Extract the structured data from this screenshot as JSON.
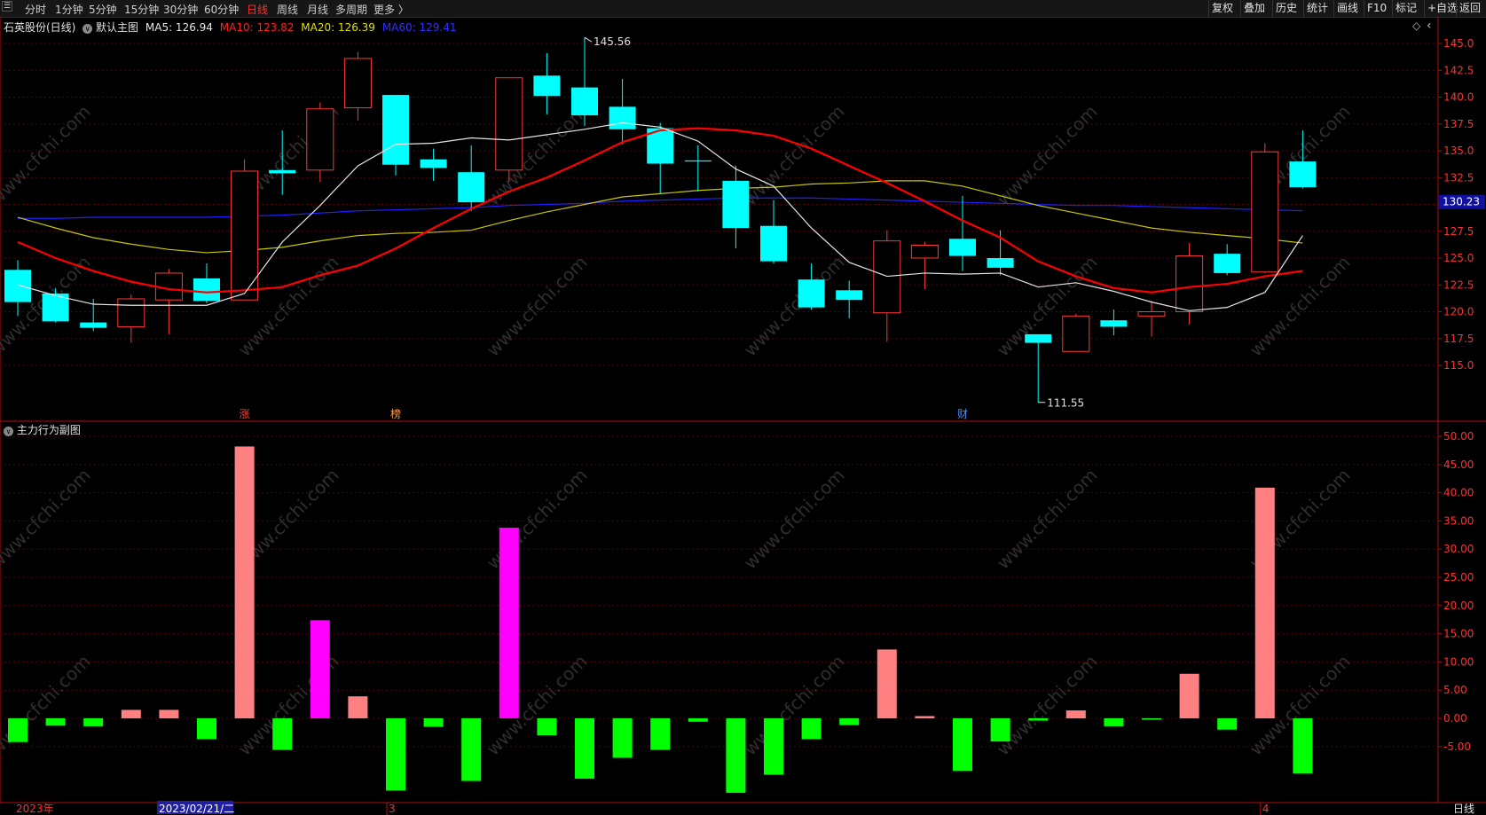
{
  "toolbar": {
    "left_items": [
      "分时",
      "1分钟",
      "5分钟",
      "15分钟",
      "30分钟",
      "60分钟",
      "日线",
      "周线",
      "月线",
      "多周期",
      "更多 〉"
    ],
    "active_item": "日线",
    "right_items": [
      "复权",
      "叠加",
      "历史",
      "统计",
      "画线",
      "F10",
      "标记",
      "+自选",
      "返回"
    ]
  },
  "main_chart": {
    "stock_title": "石英股份(日线)",
    "template": "默认主图",
    "ma5_text": "MA5: 126.94",
    "ma10_text": "MA10: 123.82",
    "ma20_text": "MA20: 126.39",
    "ma60_text": "MA60: 129.41",
    "high_label": "145.56",
    "low_label": "111.55",
    "current_price": "130.23",
    "markers": [
      "涨",
      "榜",
      "财"
    ],
    "settings_icon": "diamond-icon",
    "collapse_icon": "chevron-left-icon",
    "price_ticks": [
      "145.0",
      "142.5",
      "140.0",
      "137.5",
      "135.0",
      "132.5",
      "130.0",
      "127.5",
      "125.0",
      "122.5",
      "120.0",
      "117.5",
      "115.0"
    ]
  },
  "sub_chart": {
    "title": "主力行为副图",
    "ticks": [
      "50.00",
      "45.00",
      "40.00",
      "35.00",
      "30.00",
      "25.00",
      "20.00",
      "15.00",
      "10.00",
      "5.00",
      "0.00",
      "-5.00"
    ]
  },
  "date_axis": {
    "labels": [
      "2023年",
      "2023/02/21/二",
      "3",
      "4"
    ],
    "period": "日线"
  },
  "watermark": "www.cfchi.com",
  "colors": {
    "up": "#ff3838",
    "down": "#00ffff",
    "ma5": "#e6e6e6",
    "ma10": "#ff0000",
    "ma20": "#c8c800",
    "ma60": "#2020ff",
    "bar_up": "#ff8080",
    "bar_down": "#00ff00",
    "bar_major": "#ff00ff"
  },
  "chart_data": {
    "type": "candlestick",
    "candles": [
      {
        "o": 123.9,
        "h": 124.8,
        "l": 119.6,
        "c": 120.9
      },
      {
        "o": 121.7,
        "h": 122.2,
        "l": 119.0,
        "c": 119.1
      },
      {
        "o": 119.0,
        "h": 121.2,
        "l": 118.2,
        "c": 118.5
      },
      {
        "o": 118.6,
        "h": 121.6,
        "l": 117.1,
        "c": 121.2
      },
      {
        "o": 121.1,
        "h": 124.0,
        "l": 117.9,
        "c": 123.6
      },
      {
        "o": 123.1,
        "h": 124.5,
        "l": 120.8,
        "c": 121.0
      },
      {
        "o": 121.1,
        "h": 134.2,
        "l": 121.1,
        "c": 133.1
      },
      {
        "o": 133.2,
        "h": 136.9,
        "l": 130.9,
        "c": 132.9
      },
      {
        "o": 133.2,
        "h": 139.5,
        "l": 132.1,
        "c": 138.9
      },
      {
        "o": 139.0,
        "h": 144.2,
        "l": 137.8,
        "c": 143.6
      },
      {
        "o": 140.2,
        "h": 140.2,
        "l": 132.7,
        "c": 133.7
      },
      {
        "o": 134.2,
        "h": 135.2,
        "l": 132.2,
        "c": 133.4
      },
      {
        "o": 133.0,
        "h": 135.5,
        "l": 129.4,
        "c": 130.2
      },
      {
        "o": 133.2,
        "h": 141.8,
        "l": 132.1,
        "c": 141.8
      },
      {
        "o": 142.0,
        "h": 144.1,
        "l": 138.4,
        "c": 140.1
      },
      {
        "o": 140.9,
        "h": 145.56,
        "l": 137.3,
        "c": 138.3
      },
      {
        "o": 139.1,
        "h": 141.7,
        "l": 135.6,
        "c": 137.0
      },
      {
        "o": 137.1,
        "h": 137.6,
        "l": 131.0,
        "c": 133.8
      },
      {
        "o": 134.1,
        "h": 135.5,
        "l": 131.2,
        "c": 134.0
      },
      {
        "o": 132.2,
        "h": 133.6,
        "l": 125.9,
        "c": 127.8
      },
      {
        "o": 128.0,
        "h": 130.4,
        "l": 124.5,
        "c": 124.7
      },
      {
        "o": 123.0,
        "h": 124.5,
        "l": 120.2,
        "c": 120.4
      },
      {
        "o": 122.0,
        "h": 122.9,
        "l": 119.4,
        "c": 121.1
      },
      {
        "o": 119.9,
        "h": 127.6,
        "l": 117.2,
        "c": 126.6
      },
      {
        "o": 125.0,
        "h": 126.5,
        "l": 122.1,
        "c": 126.2
      },
      {
        "o": 126.8,
        "h": 130.8,
        "l": 123.8,
        "c": 125.2
      },
      {
        "o": 125.0,
        "h": 127.6,
        "l": 123.4,
        "c": 124.1
      },
      {
        "o": 117.9,
        "h": 117.9,
        "l": 111.55,
        "c": 117.1
      },
      {
        "o": 116.3,
        "h": 119.8,
        "l": 116.3,
        "c": 119.6
      },
      {
        "o": 119.2,
        "h": 120.2,
        "l": 117.8,
        "c": 118.6
      },
      {
        "o": 119.6,
        "h": 121.0,
        "l": 117.7,
        "c": 120.0
      },
      {
        "o": 120.0,
        "h": 126.4,
        "l": 118.8,
        "c": 125.2
      },
      {
        "o": 125.4,
        "h": 126.3,
        "l": 123.4,
        "c": 123.6
      },
      {
        "o": 123.7,
        "h": 135.7,
        "l": 123.6,
        "c": 134.9
      },
      {
        "o": 134.0,
        "h": 136.9,
        "l": 131.5,
        "c": 131.6
      }
    ],
    "ma5": [
      122.5,
      121.5,
      120.7,
      120.6,
      120.6,
      120.6,
      121.7,
      126.5,
      129.9,
      133.6,
      135.6,
      135.7,
      136.2,
      136.0,
      136.5,
      137.0,
      137.6,
      137.2,
      135.9,
      133.3,
      131.7,
      127.8,
      124.6,
      123.3,
      123.6,
      123.5,
      123.6,
      122.3,
      122.7,
      121.9,
      120.9,
      120.1,
      120.4,
      121.8,
      127.1
    ],
    "ma10": [
      126.5,
      125.0,
      123.8,
      122.8,
      122.1,
      121.8,
      122.0,
      122.3,
      123.4,
      124.3,
      125.9,
      127.8,
      129.6,
      131.2,
      132.5,
      134.1,
      135.8,
      136.9,
      137.1,
      136.9,
      136.4,
      135.2,
      133.6,
      132.0,
      130.3,
      128.5,
      126.9,
      124.7,
      123.3,
      122.2,
      121.8,
      122.3,
      122.6,
      123.3,
      123.8
    ],
    "ma20": [
      128.8,
      127.8,
      126.9,
      126.3,
      125.8,
      125.5,
      125.7,
      126.0,
      126.6,
      127.1,
      127.3,
      127.4,
      127.6,
      128.5,
      129.3,
      130.0,
      130.7,
      131.0,
      131.3,
      131.5,
      131.6,
      131.9,
      132.0,
      132.2,
      132.2,
      131.7,
      130.8,
      129.9,
      129.2,
      128.5,
      127.8,
      127.4,
      127.1,
      126.8,
      126.4
    ],
    "ma60": [
      128.7,
      128.7,
      128.8,
      128.8,
      128.8,
      128.8,
      128.9,
      129.0,
      129.2,
      129.4,
      129.5,
      129.6,
      129.7,
      129.9,
      130.0,
      130.1,
      130.3,
      130.4,
      130.5,
      130.6,
      130.6,
      130.6,
      130.5,
      130.4,
      130.3,
      130.2,
      130.1,
      130.0,
      129.9,
      129.9,
      129.8,
      129.7,
      129.6,
      129.5,
      129.41
    ],
    "behavior": [
      -4.2,
      -1.3,
      -1.4,
      1.5,
      1.5,
      -3.7,
      48.2,
      -5.6,
      17.4,
      3.9,
      -12.8,
      -1.5,
      -11.1,
      33.8,
      -3.0,
      -10.7,
      -7.0,
      -5.6,
      -0.6,
      -13.2,
      -10.0,
      -3.7,
      -1.2,
      12.2,
      0.4,
      -9.3,
      -4.1,
      -0.4,
      1.4,
      -1.4,
      -0.2,
      7.9,
      -2.0,
      40.9,
      -9.8
    ],
    "behavior_major_index": [
      8,
      13
    ],
    "price_range": [
      111,
      147
    ],
    "behavior_range": [
      -10,
      52
    ]
  }
}
